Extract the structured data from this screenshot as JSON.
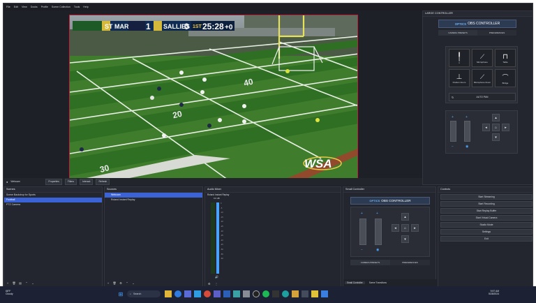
{
  "menu": [
    "File",
    "Edit",
    "View",
    "Docks",
    "Profile",
    "Scene Collection",
    "Tools",
    "Help"
  ],
  "scoreboard": {
    "home": "ST MARK'S",
    "home_score": "1",
    "away": "SALLIES",
    "away_score": "0",
    "period": "1ST",
    "clock": "25:28",
    "extra": "+0"
  },
  "field": {
    "yard_a": "40",
    "yard_b": "30",
    "yard_c": "20",
    "watermark": "WSA"
  },
  "source_toolbar": {
    "source_name": "Webcam",
    "properties": "Properties",
    "filters": "Filters",
    "interact": "Interact",
    "refresh": "Refresh"
  },
  "scenes": {
    "title": "Scenes",
    "items": [
      "Scene Backdrop for Sports",
      "Football",
      "PTZ Camera"
    ],
    "selected_index": 1
  },
  "sources": {
    "title": "Sources",
    "items": [
      "Webcam",
      "Roland Instant Replay"
    ]
  },
  "audio_mixer": {
    "title": "Audio Mixer",
    "channel": "Roland Instant Replay",
    "level": "0.0 dB",
    "scale": [
      "0",
      "-5",
      "-10",
      "-15",
      "-20",
      "-25",
      "-30",
      "-35",
      "-40",
      "-45",
      "-50",
      "-55",
      "-60"
    ]
  },
  "small_controller": {
    "title": "Small Controller",
    "brand": "OBS CONTROLLER",
    "logo_text": "OPTICS",
    "tab1": "CAMERA PRESETS",
    "tab2": "PREFERENCES",
    "dock_tab1": "Small Controller",
    "dock_tab2": "Scene Transitions"
  },
  "controls": {
    "title": "Controls",
    "buttons": [
      "Start Streaming",
      "Start Recording",
      "Start Replay Buffer",
      "Start Virtual Camera",
      "Studio Mode",
      "Settings",
      "Exit"
    ]
  },
  "large_controller": {
    "title": "LARGE CONTROLLER",
    "brand": "OBS CONTROLLER",
    "logo_text": "OPTICS",
    "tab1": "CAMERA PRESETS",
    "tab2": "PREFERENCES",
    "presets": [
      {
        "label": "1"
      },
      {
        "label": "Microphone"
      },
      {
        "label": "Table"
      },
      {
        "label": "Podium Zoom"
      },
      {
        "label": "Microphone Zoom"
      },
      {
        "label": "Bridge"
      }
    ],
    "auto_pan": "AUTO PAN"
  },
  "status_bar": {
    "live": "LIVE: 00:00:00",
    "rec": "REC: 00:00:00",
    "cpu": "CPU: 0.7%, 30.00 fps"
  },
  "taskbar": {
    "search": "Search",
    "weather_temp": "68°F",
    "weather_desc": "Cloudy",
    "time": "9:57 AM",
    "date": "5/28/2024"
  }
}
